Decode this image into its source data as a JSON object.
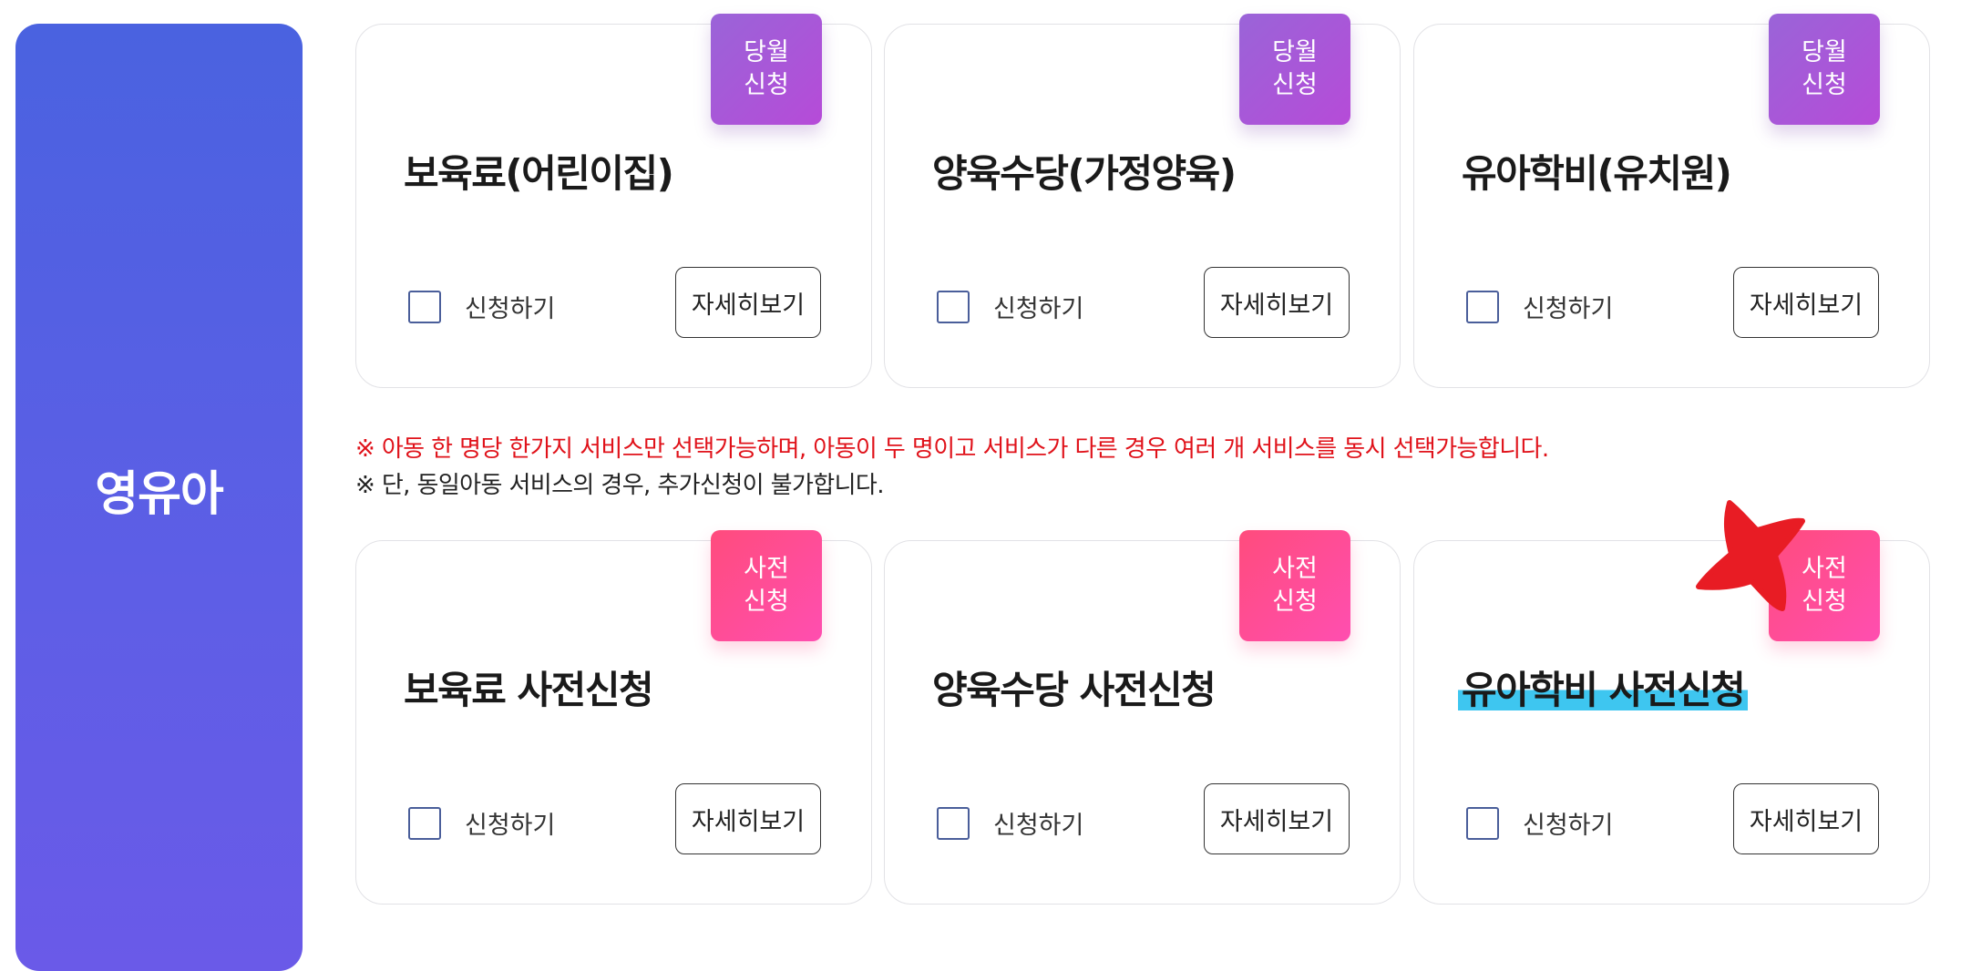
{
  "sidebar": {
    "title": "영유아"
  },
  "cards_top": [
    {
      "badge": [
        "당월",
        "신청"
      ],
      "title": "보육료(어린이집)",
      "check_label": "신청하기",
      "detail_label": "자세히보기"
    },
    {
      "badge": [
        "당월",
        "신청"
      ],
      "title": "양육수당(가정양육)",
      "check_label": "신청하기",
      "detail_label": "자세히보기"
    },
    {
      "badge": [
        "당월",
        "신청"
      ],
      "title": "유아학비(유치원)",
      "check_label": "신청하기",
      "detail_label": "자세히보기"
    }
  ],
  "notices": {
    "red": "※ 아동 한 명당 한가지 서비스만 선택가능하며, 아동이 두 명이고 서비스가 다른 경우 여러 개 서비스를 동시 선택가능합니다.",
    "black": "※ 단, 동일아동 서비스의 경우, 추가신청이 불가합니다."
  },
  "cards_bottom": [
    {
      "badge": [
        "사전",
        "신청"
      ],
      "title": "보육료 사전신청",
      "check_label": "신청하기",
      "detail_label": "자세히보기"
    },
    {
      "badge": [
        "사전",
        "신청"
      ],
      "title": "양육수당 사전신청",
      "check_label": "신청하기",
      "detail_label": "자세히보기"
    },
    {
      "badge": [
        "사전",
        "신청"
      ],
      "title": "유아학비 사전신청",
      "check_label": "신청하기",
      "detail_label": "자세히보기"
    }
  ],
  "colors": {
    "sidebar_gradient": [
      "#4a62e0",
      "#6a5ae8"
    ],
    "badge_purple": "#a95ad8",
    "badge_pink": "#ff4d96",
    "notice_red": "#e0121a",
    "highlight": "#3ec6f0",
    "star": "#e81c24"
  }
}
